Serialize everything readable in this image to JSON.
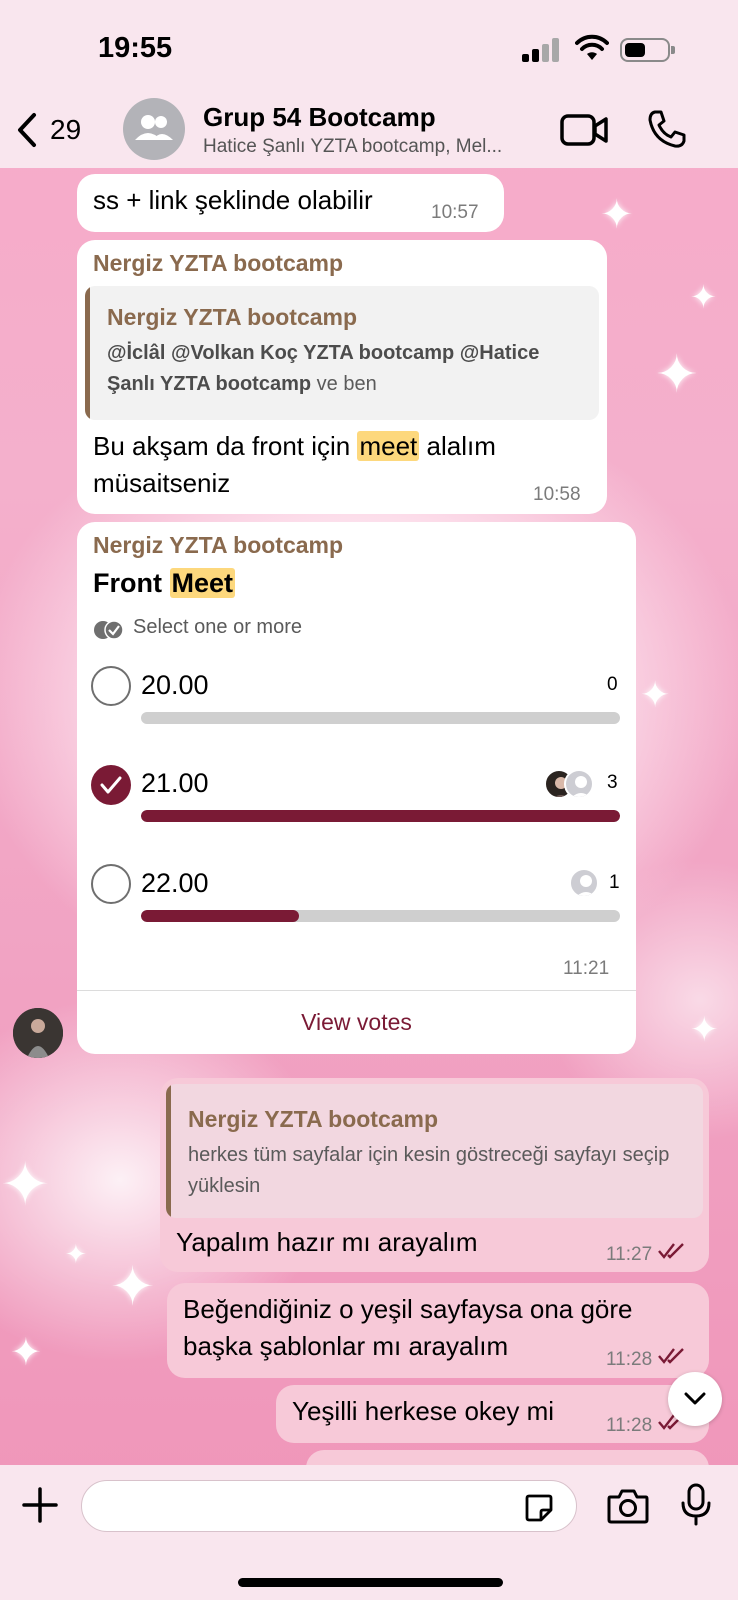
{
  "status_bar": {
    "time": "19:55"
  },
  "header": {
    "back_count": "29",
    "title": "Grup 54 Bootcamp",
    "subtitle": "Hatice Şanlı YZTA bootcamp, Mel..."
  },
  "messages": {
    "m1": {
      "text": "ss + link şeklinde olabilir",
      "time": "10:57"
    },
    "m2": {
      "sender": "Nergiz YZTA bootcamp",
      "quote_sender": "Nergiz YZTA bootcamp",
      "quote_mention_1": "@İclâl",
      "quote_mention_2": "@Volkan Koç YZTA bootcamp",
      "quote_mention_3": "@Hatice Şanlı YZTA bootcamp",
      "quote_suffix": "ve ben",
      "text_before": "Bu akşam da front için",
      "text_highlight": "meet",
      "text_after": "alalım müsaitseniz",
      "time": "10:58"
    },
    "poll": {
      "sender": "Nergiz YZTA bootcamp",
      "title_plain": "Front",
      "title_highlight": "Meet",
      "hint": "Select one or more",
      "options": [
        {
          "label": "20.00",
          "votes": "0",
          "fraction": 0,
          "checked": false
        },
        {
          "label": "21.00",
          "votes": "3",
          "fraction": 1,
          "checked": true
        },
        {
          "label": "22.00",
          "votes": "1",
          "fraction": 0.33,
          "checked": false
        }
      ],
      "time": "11:21",
      "view_votes": "View votes"
    },
    "m4": {
      "quote_sender": "Nergiz YZTA bootcamp",
      "quote_text": "herkes tüm sayfalar için kesin göstreceği sayfayı seçip yüklesin",
      "text": "Yapalım hazır mı arayalım",
      "time": "11:27"
    },
    "m5": {
      "text": "Beğendiğiniz o yeşil sayfaysa ona göre başka şablonlar mı arayalım",
      "time": "11:28"
    },
    "m6": {
      "text": "Yeşilli herkese okey mi",
      "time": "11:28"
    }
  },
  "composer": {
    "placeholder": ""
  },
  "colors": {
    "accent": "#7a1a35",
    "sender": "#8a6a4e",
    "highlight": "#fdd87d",
    "outgoing": "#f7c9d8"
  },
  "icons": [
    "back-chevron-icon",
    "group-icon",
    "video-camera-icon",
    "phone-icon",
    "double-check-icon",
    "scroll-down-icon",
    "plus-icon",
    "sticker-icon",
    "camera-icon",
    "microphone-icon"
  ]
}
